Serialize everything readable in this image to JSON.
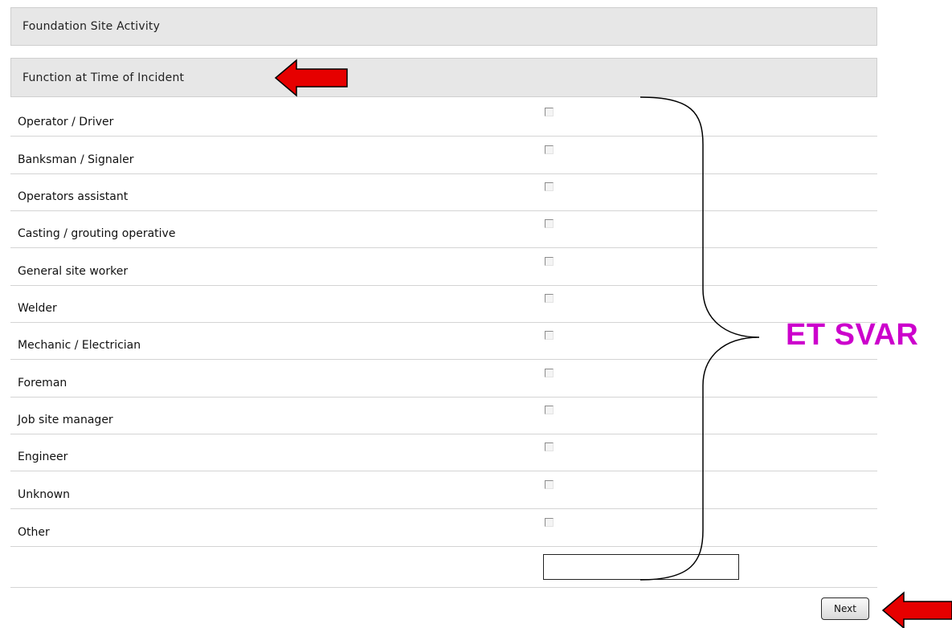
{
  "section_activity": {
    "title": "Foundation Site Activity"
  },
  "section_function": {
    "title": "Function at Time of Incident"
  },
  "options": [
    {
      "label": "Operator / Driver",
      "checked": false
    },
    {
      "label": "Banksman / Signaler",
      "checked": false
    },
    {
      "label": "Operators assistant",
      "checked": false
    },
    {
      "label": "Casting / grouting operative",
      "checked": false
    },
    {
      "label": "General site worker",
      "checked": false
    },
    {
      "label": "Welder",
      "checked": false
    },
    {
      "label": "Mechanic / Electrician",
      "checked": false
    },
    {
      "label": "Foreman",
      "checked": false
    },
    {
      "label": "Job site manager",
      "checked": false
    },
    {
      "label": "Engineer",
      "checked": false
    },
    {
      "label": "Unknown",
      "checked": false
    },
    {
      "label": "Other",
      "checked": false
    }
  ],
  "other_input": {
    "value": ""
  },
  "next_button": {
    "label": "Next"
  },
  "annotation": {
    "text": "ET SVAR",
    "color": "#cc00cc"
  },
  "arrow_color": "#e60000",
  "icons": [
    "left-arrow-icon",
    "curly-brace-icon",
    "checkbox-icon"
  ]
}
